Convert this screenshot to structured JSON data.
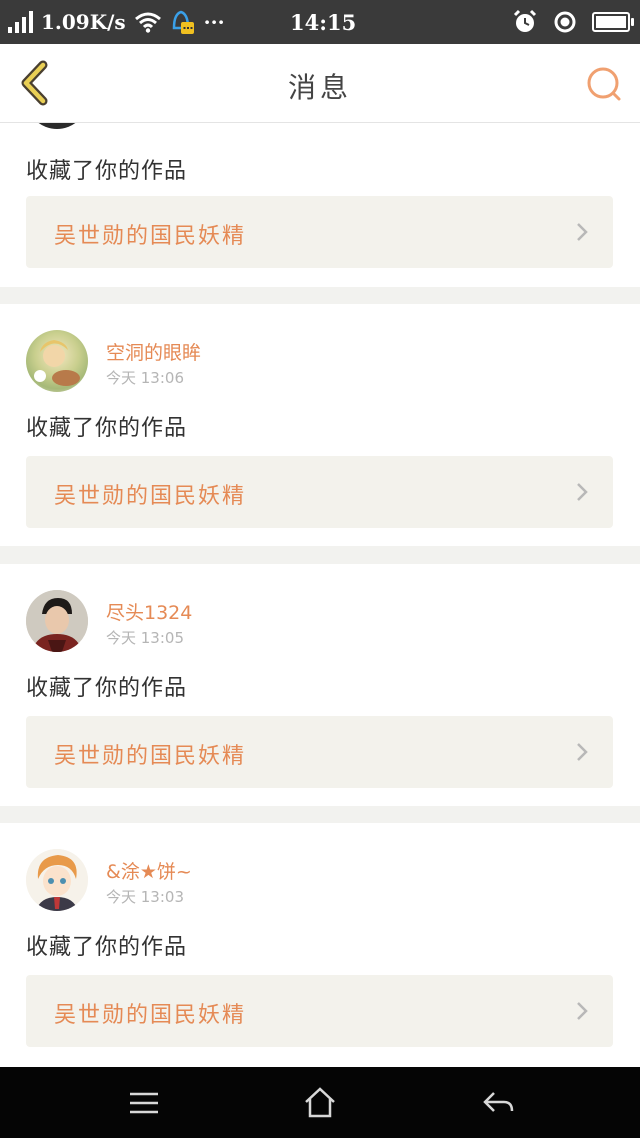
{
  "status_bar": {
    "net_speed": "1.09K/s",
    "more": "···",
    "time": "14:15"
  },
  "header": {
    "title": "消息"
  },
  "notifications": [
    {
      "action": "收藏了你的作品",
      "work_title": "吴世勋的国民妖精"
    },
    {
      "username": "空洞的眼眸",
      "time": "今天  13:06",
      "action": "收藏了你的作品",
      "work_title": "吴世勋的国民妖精"
    },
    {
      "username": "尽头1324",
      "time": "今天  13:05",
      "action": "收藏了你的作品",
      "work_title": "吴世勋的国民妖精"
    },
    {
      "username": "&涂★饼~",
      "time": "今天  13:03",
      "action": "收藏了你的作品",
      "work_title": "吴世勋的国民妖精"
    }
  ],
  "colors": {
    "accent": "#e58a55",
    "back_arrow": "#d8b84a",
    "work_box_bg": "#f3f2ec"
  },
  "icons": {
    "back": "chevron-left-icon",
    "search": "search-icon",
    "menu": "menu-icon",
    "home": "home-icon",
    "return": "back-arrow-icon"
  }
}
